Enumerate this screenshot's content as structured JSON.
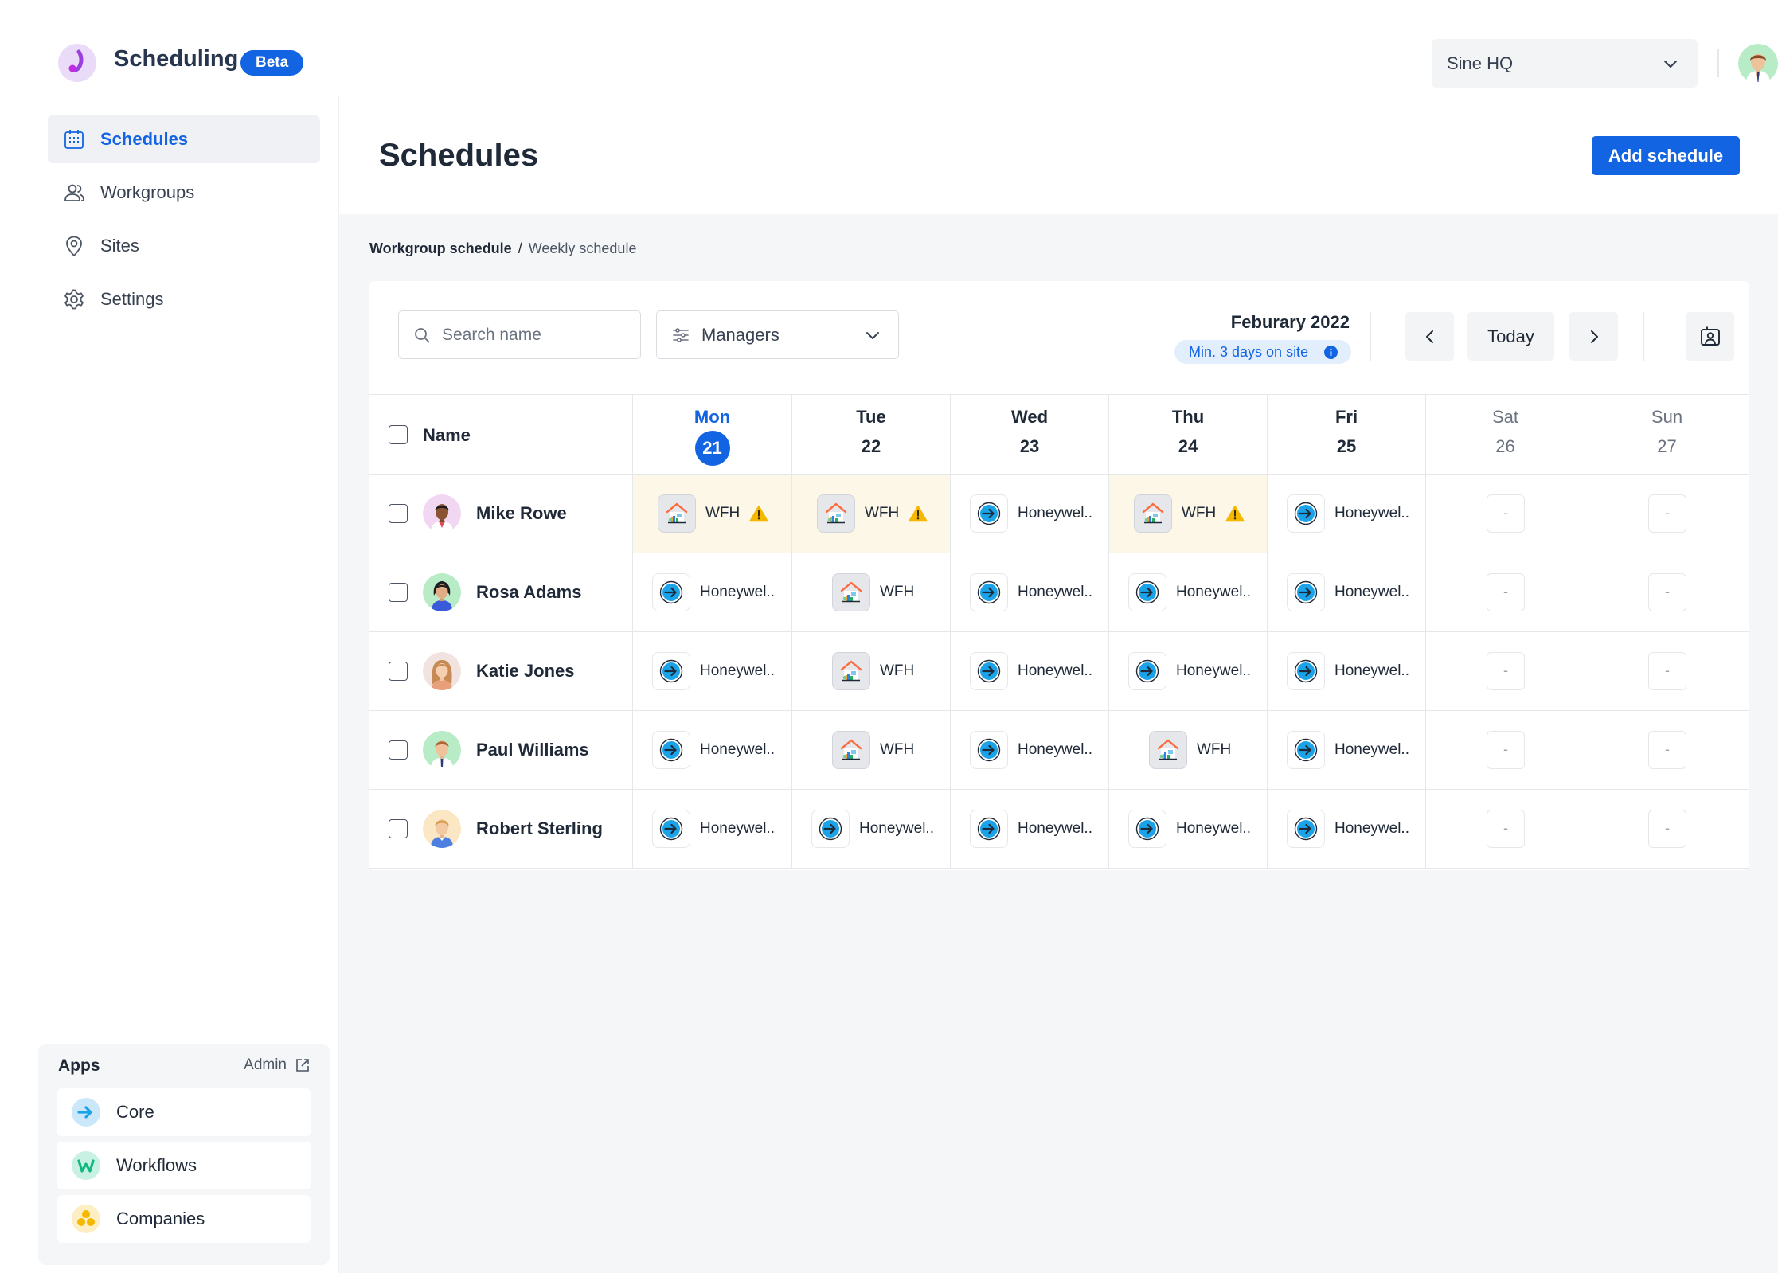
{
  "app": {
    "name": "Scheduling",
    "badge": "Beta"
  },
  "org_select": {
    "value": "Sine HQ"
  },
  "sidebar": {
    "items": [
      {
        "label": "Schedules",
        "icon": "calendar-icon",
        "active": true
      },
      {
        "label": "Workgroups",
        "icon": "users-icon",
        "active": false
      },
      {
        "label": "Sites",
        "icon": "map-pin-icon",
        "active": false
      },
      {
        "label": "Settings",
        "icon": "gear-icon",
        "active": false
      }
    ],
    "apps": {
      "title": "Apps",
      "admin_label": "Admin",
      "items": [
        {
          "label": "Core",
          "icon": "core-app-icon"
        },
        {
          "label": "Workflows",
          "icon": "workflows-app-icon"
        },
        {
          "label": "Companies",
          "icon": "companies-app-icon"
        }
      ]
    }
  },
  "main": {
    "title": "Schedules",
    "add_button": "Add schedule",
    "breadcrumb": {
      "parent": "Workgroup schedule",
      "separator": "/",
      "current": "Weekly schedule"
    },
    "toolbar": {
      "search_placeholder": "Search name",
      "filter_value": "Managers",
      "month": "Feburary 2022",
      "requirement": "Min. 3 days on site",
      "today_label": "Today"
    },
    "table": {
      "name_header": "Name",
      "days": [
        {
          "name": "Mon",
          "date": "21",
          "today": true
        },
        {
          "name": "Tue",
          "date": "22"
        },
        {
          "name": "Wed",
          "date": "23"
        },
        {
          "name": "Thu",
          "date": "24"
        },
        {
          "name": "Fri",
          "date": "25"
        },
        {
          "name": "Sat",
          "date": "26",
          "weekend": true
        },
        {
          "name": "Sun",
          "date": "27",
          "weekend": true
        }
      ],
      "rows": [
        {
          "name": "Mike Rowe",
          "cells": [
            {
              "type": "wfh",
              "label": "WFH",
              "warning": true
            },
            {
              "type": "wfh",
              "label": "WFH",
              "warning": true
            },
            {
              "type": "site",
              "label": "Honeywel.."
            },
            {
              "type": "wfh",
              "label": "WFH",
              "warning": true
            },
            {
              "type": "site",
              "label": "Honeywel.."
            },
            {
              "type": "empty",
              "label": "-"
            },
            {
              "type": "empty",
              "label": "-"
            }
          ]
        },
        {
          "name": "Rosa Adams",
          "cells": [
            {
              "type": "site",
              "label": "Honeywel.."
            },
            {
              "type": "wfh",
              "label": "WFH"
            },
            {
              "type": "site",
              "label": "Honeywel.."
            },
            {
              "type": "site",
              "label": "Honeywel.."
            },
            {
              "type": "site",
              "label": "Honeywel.."
            },
            {
              "type": "empty",
              "label": "-"
            },
            {
              "type": "empty",
              "label": "-"
            }
          ]
        },
        {
          "name": "Katie Jones",
          "cells": [
            {
              "type": "site",
              "label": "Honeywel.."
            },
            {
              "type": "wfh",
              "label": "WFH"
            },
            {
              "type": "site",
              "label": "Honeywel.."
            },
            {
              "type": "site",
              "label": "Honeywel.."
            },
            {
              "type": "site",
              "label": "Honeywel.."
            },
            {
              "type": "empty",
              "label": "-"
            },
            {
              "type": "empty",
              "label": "-"
            }
          ]
        },
        {
          "name": "Paul Williams",
          "cells": [
            {
              "type": "site",
              "label": "Honeywel.."
            },
            {
              "type": "wfh",
              "label": "WFH"
            },
            {
              "type": "site",
              "label": "Honeywel.."
            },
            {
              "type": "wfh",
              "label": "WFH"
            },
            {
              "type": "site",
              "label": "Honeywel.."
            },
            {
              "type": "empty",
              "label": "-"
            },
            {
              "type": "empty",
              "label": "-"
            }
          ]
        },
        {
          "name": "Robert Sterling",
          "cells": [
            {
              "type": "site",
              "label": "Honeywel.."
            },
            {
              "type": "site",
              "label": "Honeywel.."
            },
            {
              "type": "site",
              "label": "Honeywel.."
            },
            {
              "type": "site",
              "label": "Honeywel.."
            },
            {
              "type": "site",
              "label": "Honeywel.."
            },
            {
              "type": "empty",
              "label": "-"
            },
            {
              "type": "empty",
              "label": "-"
            }
          ]
        }
      ]
    }
  },
  "colors": {
    "accent": "#1264e3",
    "warning_bg": "#fdf7e7",
    "warning_icon": "#f5b800",
    "site_icon": "#1aa3e8",
    "background": "#f5f6f8"
  }
}
